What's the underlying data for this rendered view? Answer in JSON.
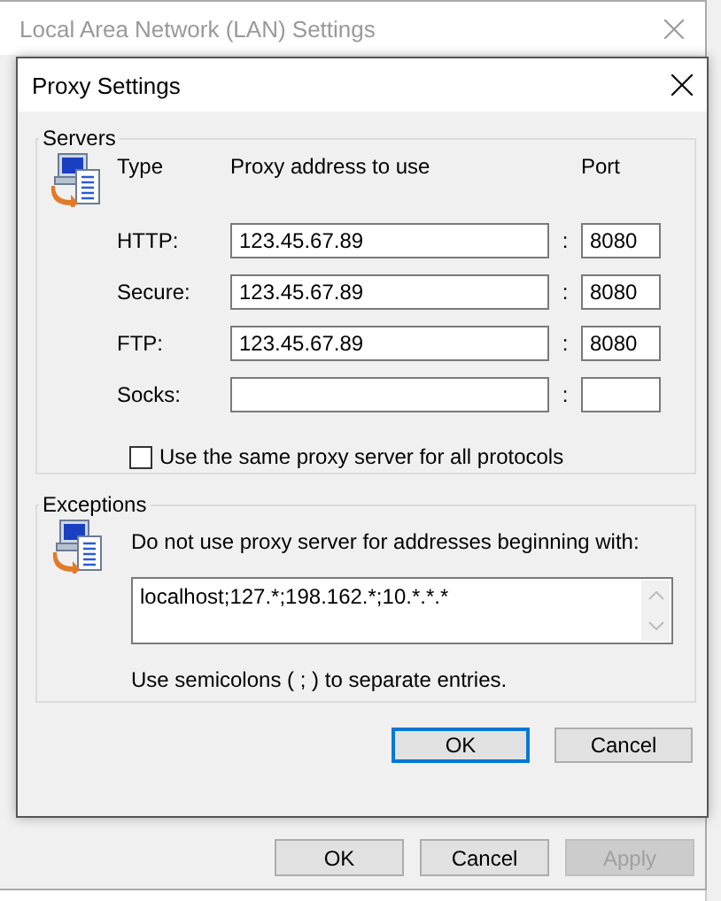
{
  "back_window": {
    "title": "Local Area Network (LAN) Settings",
    "buttons": [
      {
        "label": "OK",
        "disabled": false
      },
      {
        "label": "Cancel",
        "disabled": false
      },
      {
        "label": "Apply",
        "disabled": true
      }
    ]
  },
  "dialog": {
    "title": "Proxy Settings",
    "servers": {
      "label": "Servers",
      "headers": [
        "Type",
        "Proxy address to use",
        "Port"
      ],
      "rows": [
        {
          "type": "HTTP:",
          "address": "123.45.67.89",
          "separator": ":",
          "port": "8080"
        },
        {
          "type": "Secure:",
          "address": "123.45.67.89",
          "separator": ":",
          "port": "8080"
        },
        {
          "type": "FTP:",
          "address": "123.45.67.89",
          "separator": ":",
          "port": "8080"
        },
        {
          "type": "Socks:",
          "separator": ":"
        }
      ],
      "same_proxy": {
        "label": "Use the same proxy server for all protocols",
        "checked": false
      }
    },
    "exceptions": {
      "label": "Exceptions",
      "instruction": "Do not use proxy server for addresses beginning with:",
      "value": "localhost;127.*;198.162.*;10.*.*.*",
      "hint": "Use semicolons ( ; ) to separate entries."
    },
    "buttons": [
      {
        "label": "OK",
        "default": true
      },
      {
        "label": "Cancel",
        "default": false
      }
    ]
  }
}
